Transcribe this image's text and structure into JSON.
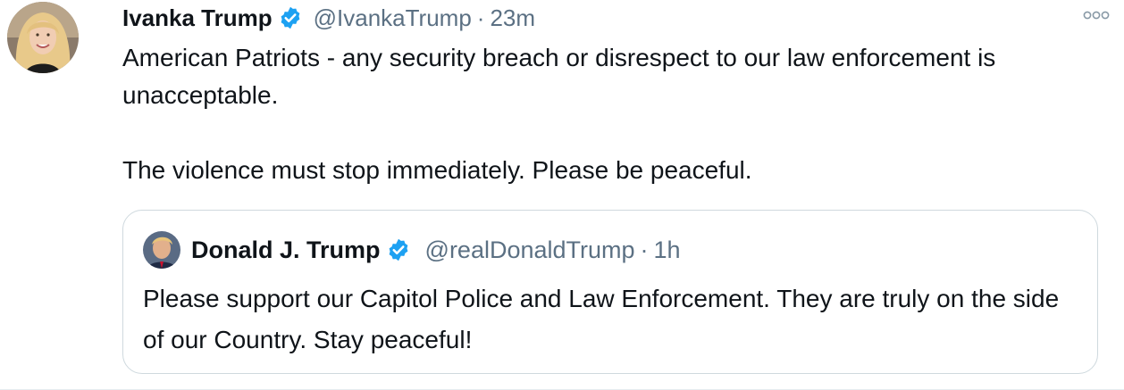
{
  "tweet": {
    "author": {
      "name": "Ivanka Trump",
      "handle": "@IvankaTrump",
      "verified": true
    },
    "separator": "·",
    "time": "23m",
    "text_lines": [
      "American Patriots - any security breach or disrespect to our law enforcement is unacceptable.",
      "The violence must stop immediately. Please be peaceful."
    ],
    "quoted": {
      "author": {
        "name": "Donald J. Trump",
        "handle": "@realDonaldTrump",
        "verified": true
      },
      "separator": "·",
      "time": "1h",
      "text": "Please support our Capitol Police and Law Enforcement. They are truly on the side of our Country. Stay peaceful!"
    }
  },
  "icons": {
    "verified": "verified-badge-icon",
    "more": "more-options-icon"
  },
  "colors": {
    "verified_blue": "#1da1f2",
    "secondary_text": "#5b7083",
    "border": "#cfd9de"
  }
}
